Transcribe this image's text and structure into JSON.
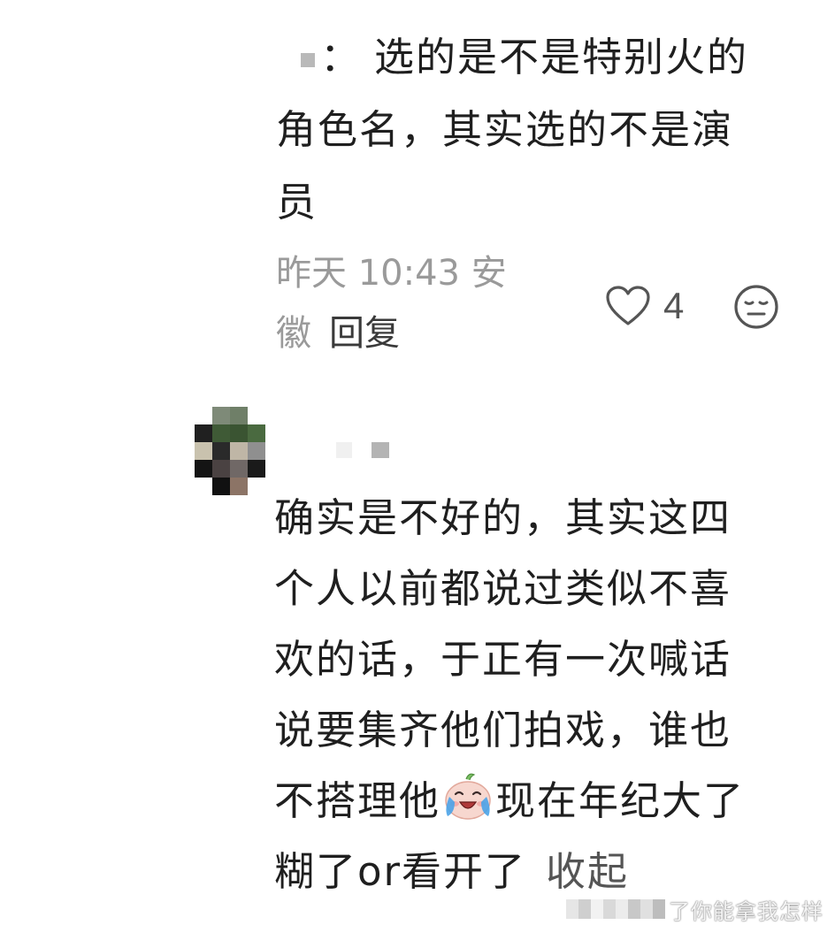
{
  "comment_1": {
    "author_colon": "：",
    "text_lines": [
      "选的是不是特别火的",
      "角色名，其实选的不是演",
      "员"
    ],
    "meta_time": "昨天 10:43 安",
    "meta_location": "徽",
    "reply_label": "回复",
    "like_count": "4",
    "like_icon": "heart-outline-icon",
    "dislike_icon": "expressionless-face-icon"
  },
  "comment_2": {
    "text_lines": [
      "确实是不好的，其实这四",
      "个人以前都说过类似不喜",
      "欢的话，于正有一次喊话",
      "说要集齐他们拍戏，谁也"
    ],
    "line5_before_emoji": "不搭理他",
    "emoji_name": "crying-laughing-face-emoji",
    "line5_after_emoji": "现在年纪大了",
    "line6_text": "糊了or看开了",
    "collapse_label": "收起"
  },
  "watermark": {
    "text": "了你能拿我怎样"
  },
  "colors": {
    "text": "#1f1f1f",
    "meta": "#9a9a9a",
    "link": "#3a3a3a",
    "icon": "#555555"
  }
}
